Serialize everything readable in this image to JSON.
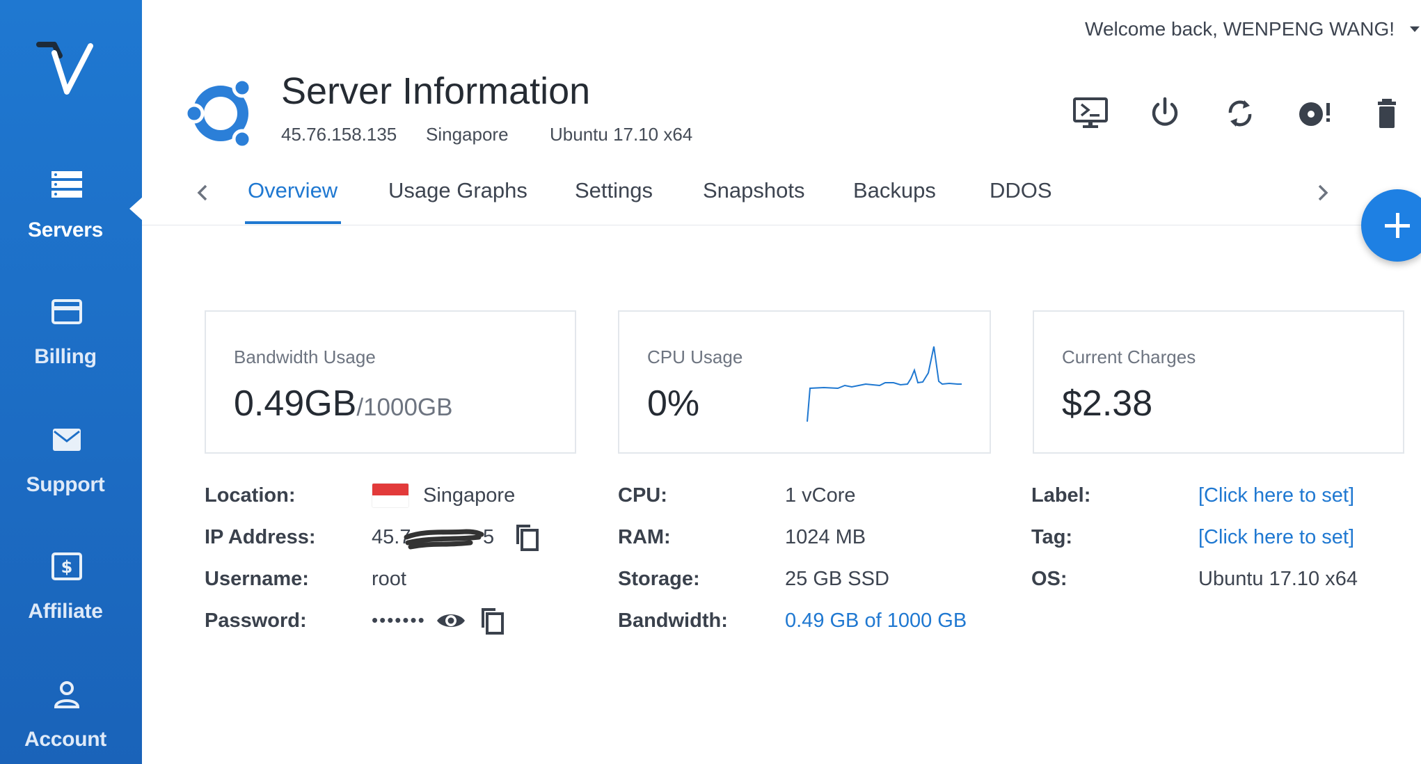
{
  "sidebar": {
    "items": [
      {
        "label": "Servers",
        "icon": "servers-icon",
        "active": true
      },
      {
        "label": "Billing",
        "icon": "credit-card-icon",
        "active": false
      },
      {
        "label": "Support",
        "icon": "envelope-icon",
        "active": false
      },
      {
        "label": "Affiliate",
        "icon": "dollar-bill-icon",
        "active": false
      },
      {
        "label": "Account",
        "icon": "user-icon",
        "active": false
      }
    ]
  },
  "header": {
    "welcome": "Welcome back, WENPENG WANG!",
    "title": "Server Information",
    "ip": "45.76.158.135",
    "location": "Singapore",
    "os": "Ubuntu 17.10 x64",
    "actions": [
      "console-icon",
      "power-icon",
      "restart-icon",
      "reinstall-icon",
      "trash-icon"
    ]
  },
  "tabs": [
    "Overview",
    "Usage Graphs",
    "Settings",
    "Snapshots",
    "Backups",
    "DDOS"
  ],
  "active_tab": "Overview",
  "cards": {
    "bandwidth": {
      "title": "Bandwidth Usage",
      "value": "0.49GB",
      "suffix": "/1000GB"
    },
    "cpu": {
      "title": "CPU Usage",
      "value": "0%"
    },
    "charges": {
      "title": "Current Charges",
      "value": "$2.38"
    }
  },
  "details": {
    "location_label": "Location:",
    "location_value": "Singapore",
    "ip_label": "IP Address:",
    "ip_value": "45.7",
    "ip_value_end": "5",
    "username_label": "Username:",
    "username_value": "root",
    "password_label": "Password:",
    "password_value": "•••••••",
    "cpu_label": "CPU:",
    "cpu_value": "1 vCore",
    "ram_label": "RAM:",
    "ram_value": "1024 MB",
    "storage_label": "Storage:",
    "storage_value": "25 GB SSD",
    "bandwidth_label": "Bandwidth:",
    "bandwidth_value": "0.49 GB of 1000 GB",
    "label_label": "Label:",
    "label_value": "[Click here to set]",
    "tag_label": "Tag:",
    "tag_value": "[Click here to set]",
    "os_label": "OS:",
    "os_value": "Ubuntu 17.10 x64"
  },
  "colors": {
    "sidebar": "#1f78d1",
    "accent": "#1f78d1",
    "fab": "#1e80e3",
    "flag_red": "#e23a3a"
  }
}
